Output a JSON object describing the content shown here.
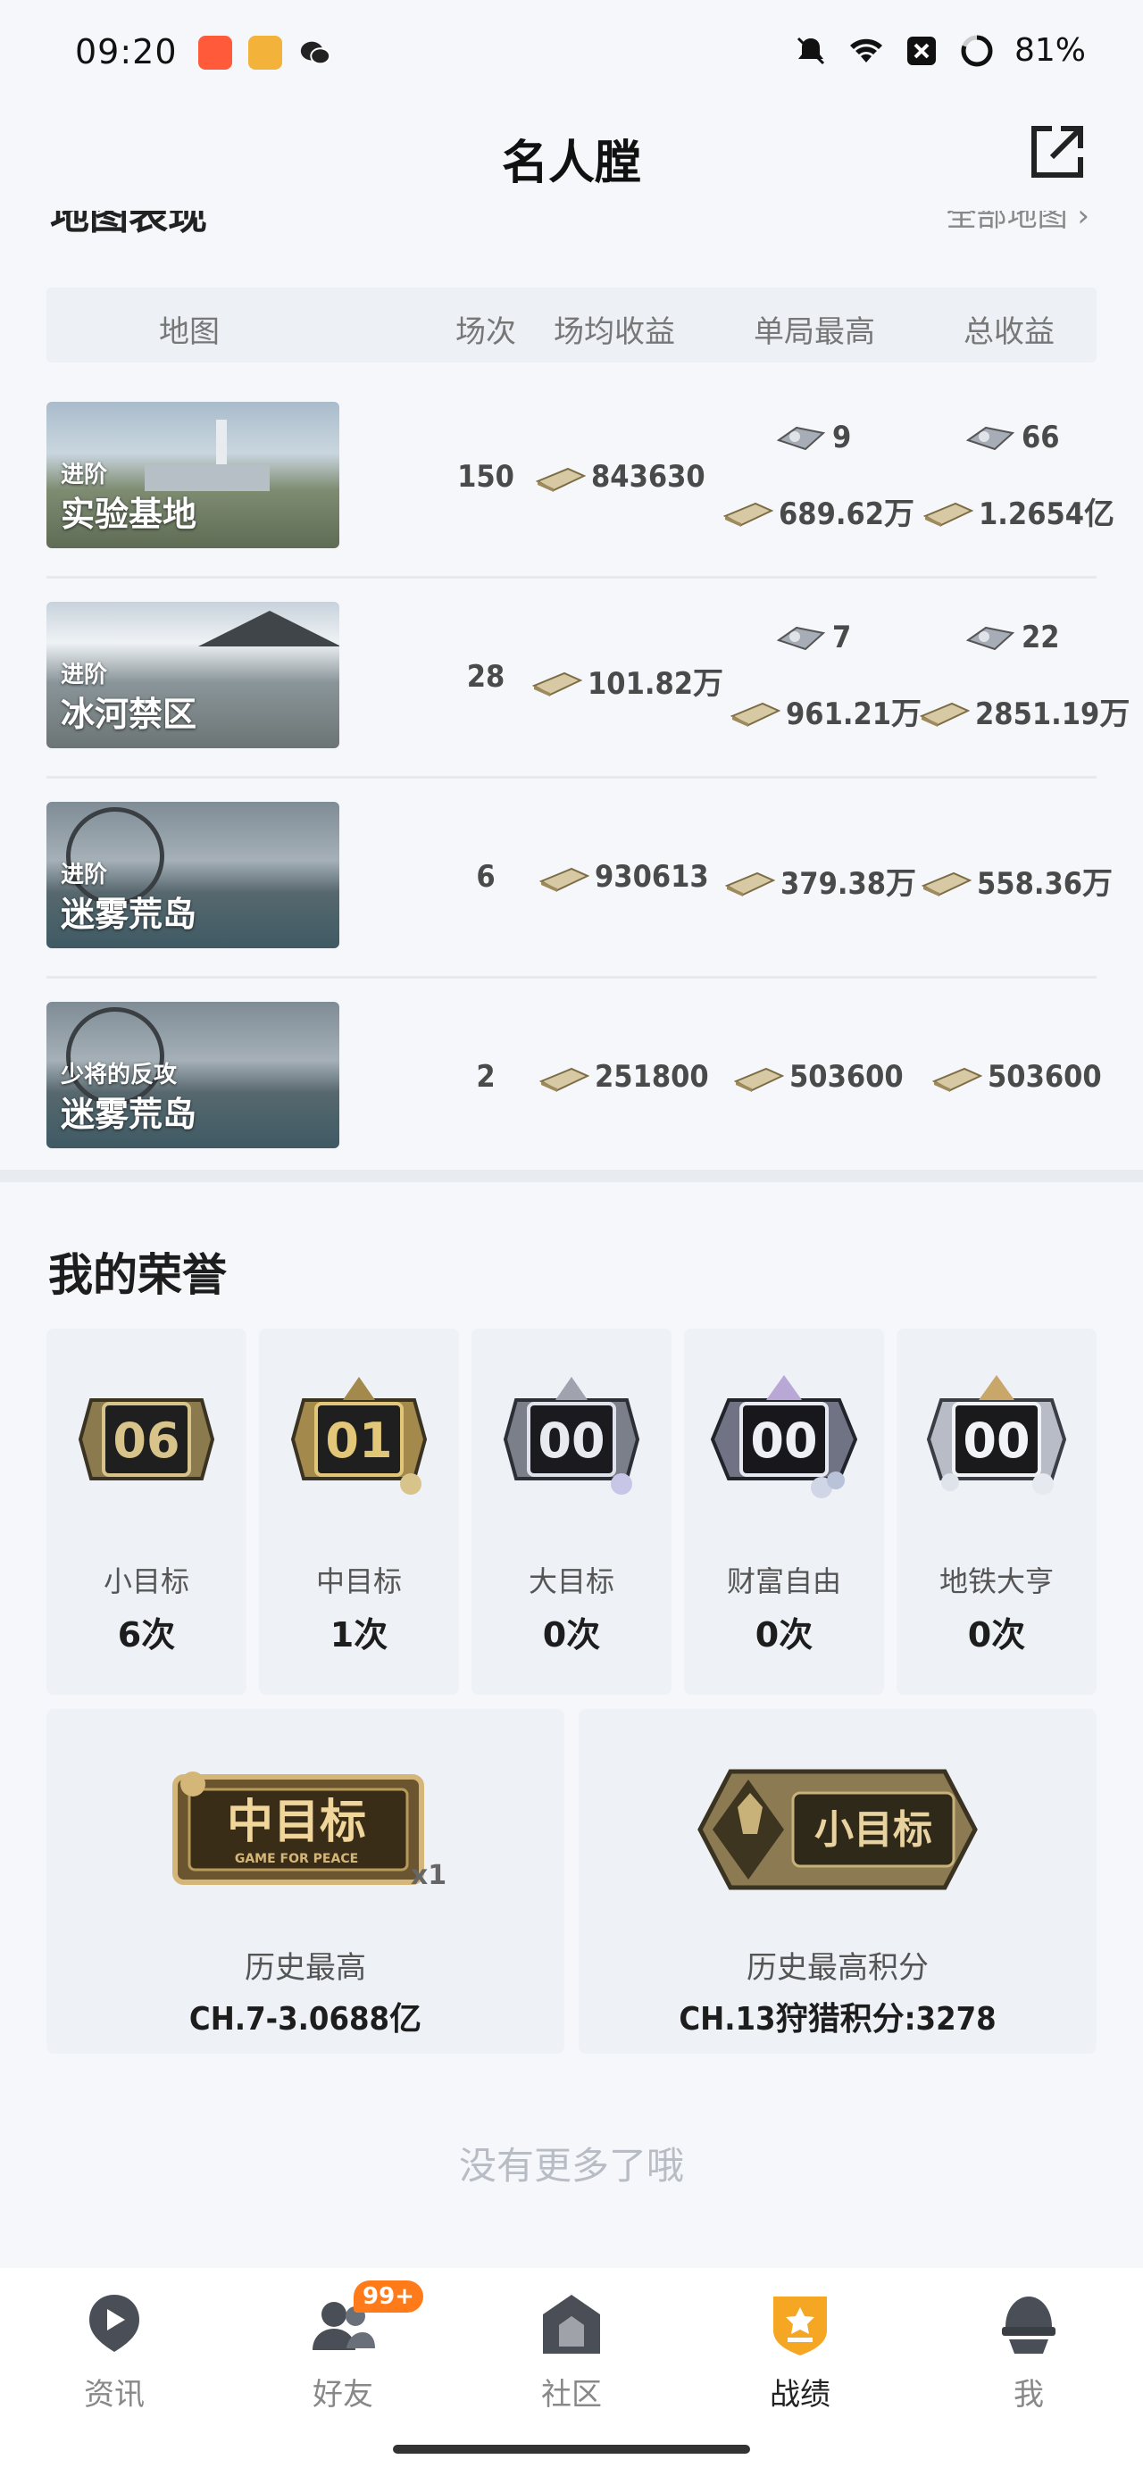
{
  "status_bar": {
    "time": "09:20",
    "battery": "81%"
  },
  "header": {
    "title": "名人膛"
  },
  "map_section": {
    "title": "地图表现",
    "all_maps_link": "全部地图 ›",
    "columns": [
      "地图",
      "场次",
      "场均收益",
      "单局最高",
      "总收益"
    ],
    "rows": [
      {
        "mode": "进阶",
        "map": "实验基地",
        "matches": "150",
        "avg": "843630",
        "best_count": "9",
        "best_value": "689.62万",
        "total_count": "66",
        "total_value": "1.2654亿"
      },
      {
        "mode": "进阶",
        "map": "冰河禁区",
        "matches": "28",
        "avg": "101.82万",
        "best_count": "7",
        "best_value": "961.21万",
        "total_count": "22",
        "total_value": "2851.19万"
      },
      {
        "mode": "进阶",
        "map": "迷雾荒岛",
        "matches": "6",
        "avg": "930613",
        "best_count": "",
        "best_value": "379.38万",
        "total_count": "",
        "total_value": "558.36万"
      },
      {
        "mode": "少将的反攻",
        "map": "迷雾荒岛",
        "matches": "2",
        "avg": "251800",
        "best_count": "",
        "best_value": "503600",
        "total_count": "",
        "total_value": "503600"
      }
    ]
  },
  "honors": {
    "title": "我的荣誉",
    "items": [
      {
        "badge_number": "06",
        "label": "小目标",
        "count": "6次",
        "color": "#b8a06a"
      },
      {
        "badge_number": "01",
        "label": "中目标",
        "count": "1次",
        "color": "#c9aa60"
      },
      {
        "badge_number": "00",
        "label": "大目标",
        "count": "0次",
        "color": "#8d8f99"
      },
      {
        "badge_number": "00",
        "label": "财富自由",
        "count": "0次",
        "color": "#9aa0b5"
      },
      {
        "badge_number": "00",
        "label": "地铁大亨",
        "count": "0次",
        "color": "#c0c4cc"
      }
    ],
    "records": [
      {
        "badge_text": "中目标",
        "badge_sub": "GAME FOR PEACE",
        "badge_multiplier": "x1",
        "label": "历史最高",
        "value": "CH.7-3.0688亿"
      },
      {
        "badge_text": "小目标",
        "label": "历史最高积分",
        "value": "CH.13狩猎积分:3278"
      }
    ]
  },
  "no_more": "没有更多了哦",
  "bottom_nav": {
    "items": [
      {
        "label": "资讯",
        "icon": "news-icon"
      },
      {
        "label": "好友",
        "icon": "friends-icon",
        "badge": "99+"
      },
      {
        "label": "社区",
        "icon": "community-icon"
      },
      {
        "label": "战绩",
        "icon": "record-icon",
        "active": true
      },
      {
        "label": "我",
        "icon": "profile-icon"
      }
    ]
  },
  "colors": {
    "accent": "#f5a623",
    "badge": "#ff7b1a",
    "background": "#f5f7fb"
  }
}
